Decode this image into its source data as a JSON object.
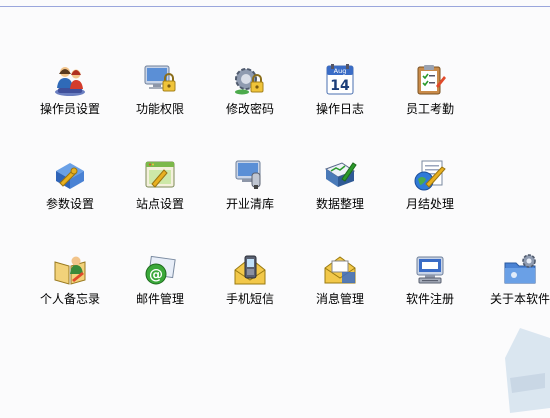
{
  "grid": {
    "row1": [
      {
        "label": "操作员设置",
        "icon": "users-icon"
      },
      {
        "label": "功能权限",
        "icon": "monitor-lock-icon"
      },
      {
        "label": "修改密码",
        "icon": "gear-lock-icon"
      },
      {
        "label": "操作日志",
        "icon": "calendar-icon"
      },
      {
        "label": "员工考勤",
        "icon": "clipboard-icon"
      }
    ],
    "row2": [
      {
        "label": "参数设置",
        "icon": "hdd-wrench-icon"
      },
      {
        "label": "站点设置",
        "icon": "window-pencil-icon"
      },
      {
        "label": "开业清库",
        "icon": "monitor-brush-icon"
      },
      {
        "label": "数据整理",
        "icon": "chart-pencil-icon"
      },
      {
        "label": "月结处理",
        "icon": "globe-doc-icon"
      }
    ],
    "row3": [
      {
        "label": "个人备忘录",
        "icon": "book-person-icon"
      },
      {
        "label": "邮件管理",
        "icon": "email-icon"
      },
      {
        "label": "手机短信",
        "icon": "phone-envelope-icon"
      },
      {
        "label": "消息管理",
        "icon": "message-envelope-icon"
      },
      {
        "label": "软件注册",
        "icon": "register-monitor-icon"
      },
      {
        "label": "关于本软件",
        "icon": "folder-gear-icon"
      }
    ]
  },
  "calendar_icon_text": {
    "month": "Aug",
    "day": "14"
  },
  "colors": {
    "rule": "#9aa6dc",
    "background": "#fbfbfc"
  }
}
